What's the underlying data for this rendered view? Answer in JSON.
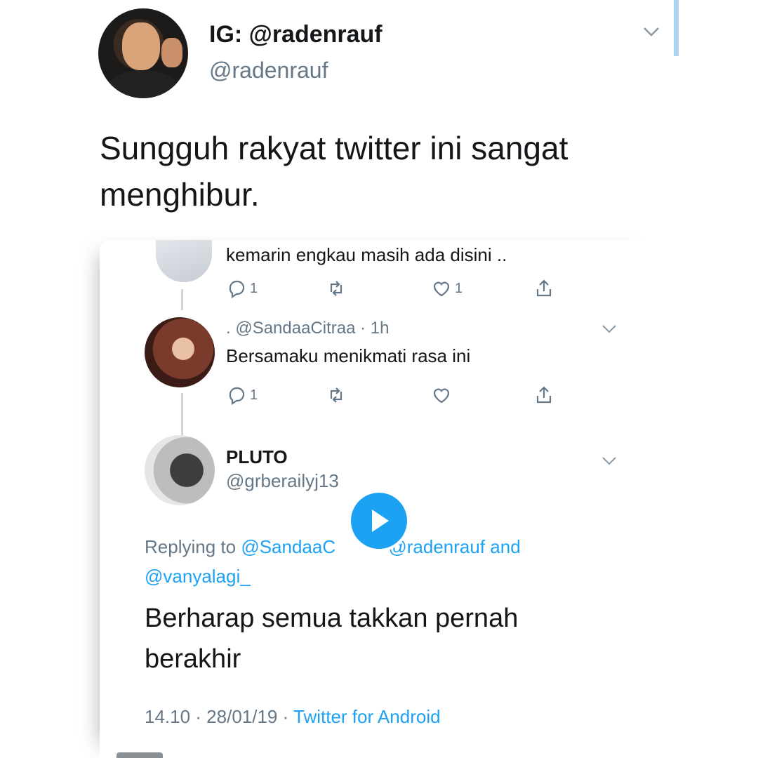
{
  "tweet": {
    "display_name": "IG: @radenrauf",
    "handle": "@radenrauf",
    "text": "Sungguh rakyat twitter ini sangat menghibur.",
    "avatar_icon": "profile-photo"
  },
  "embedded": {
    "reply1": {
      "text": "kemarin engkau masih ada disini ..",
      "reply_count": "1",
      "like_count": "1"
    },
    "reply2": {
      "meta": ". @SandaaCitraa · 1h",
      "text": "Bersamaku menikmati rasa ini",
      "reply_count": "1"
    },
    "main": {
      "display_name": "PLUTO",
      "handle": "@grberailyj13",
      "replying_prefix": "Replying to ",
      "replying_mention1": "@SandaaC",
      "replying_mention2": " @radenrauf",
      "replying_and": " and",
      "replying_mention3": "@vanyalagi_",
      "text": "Berharap semua takkan pernah berakhir",
      "timestamp": "14.10 · 28/01/19 · ",
      "source": "Twitter for Android"
    }
  },
  "colors": {
    "accent": "#1da1f2",
    "muted": "#657786",
    "text": "#14171a"
  }
}
